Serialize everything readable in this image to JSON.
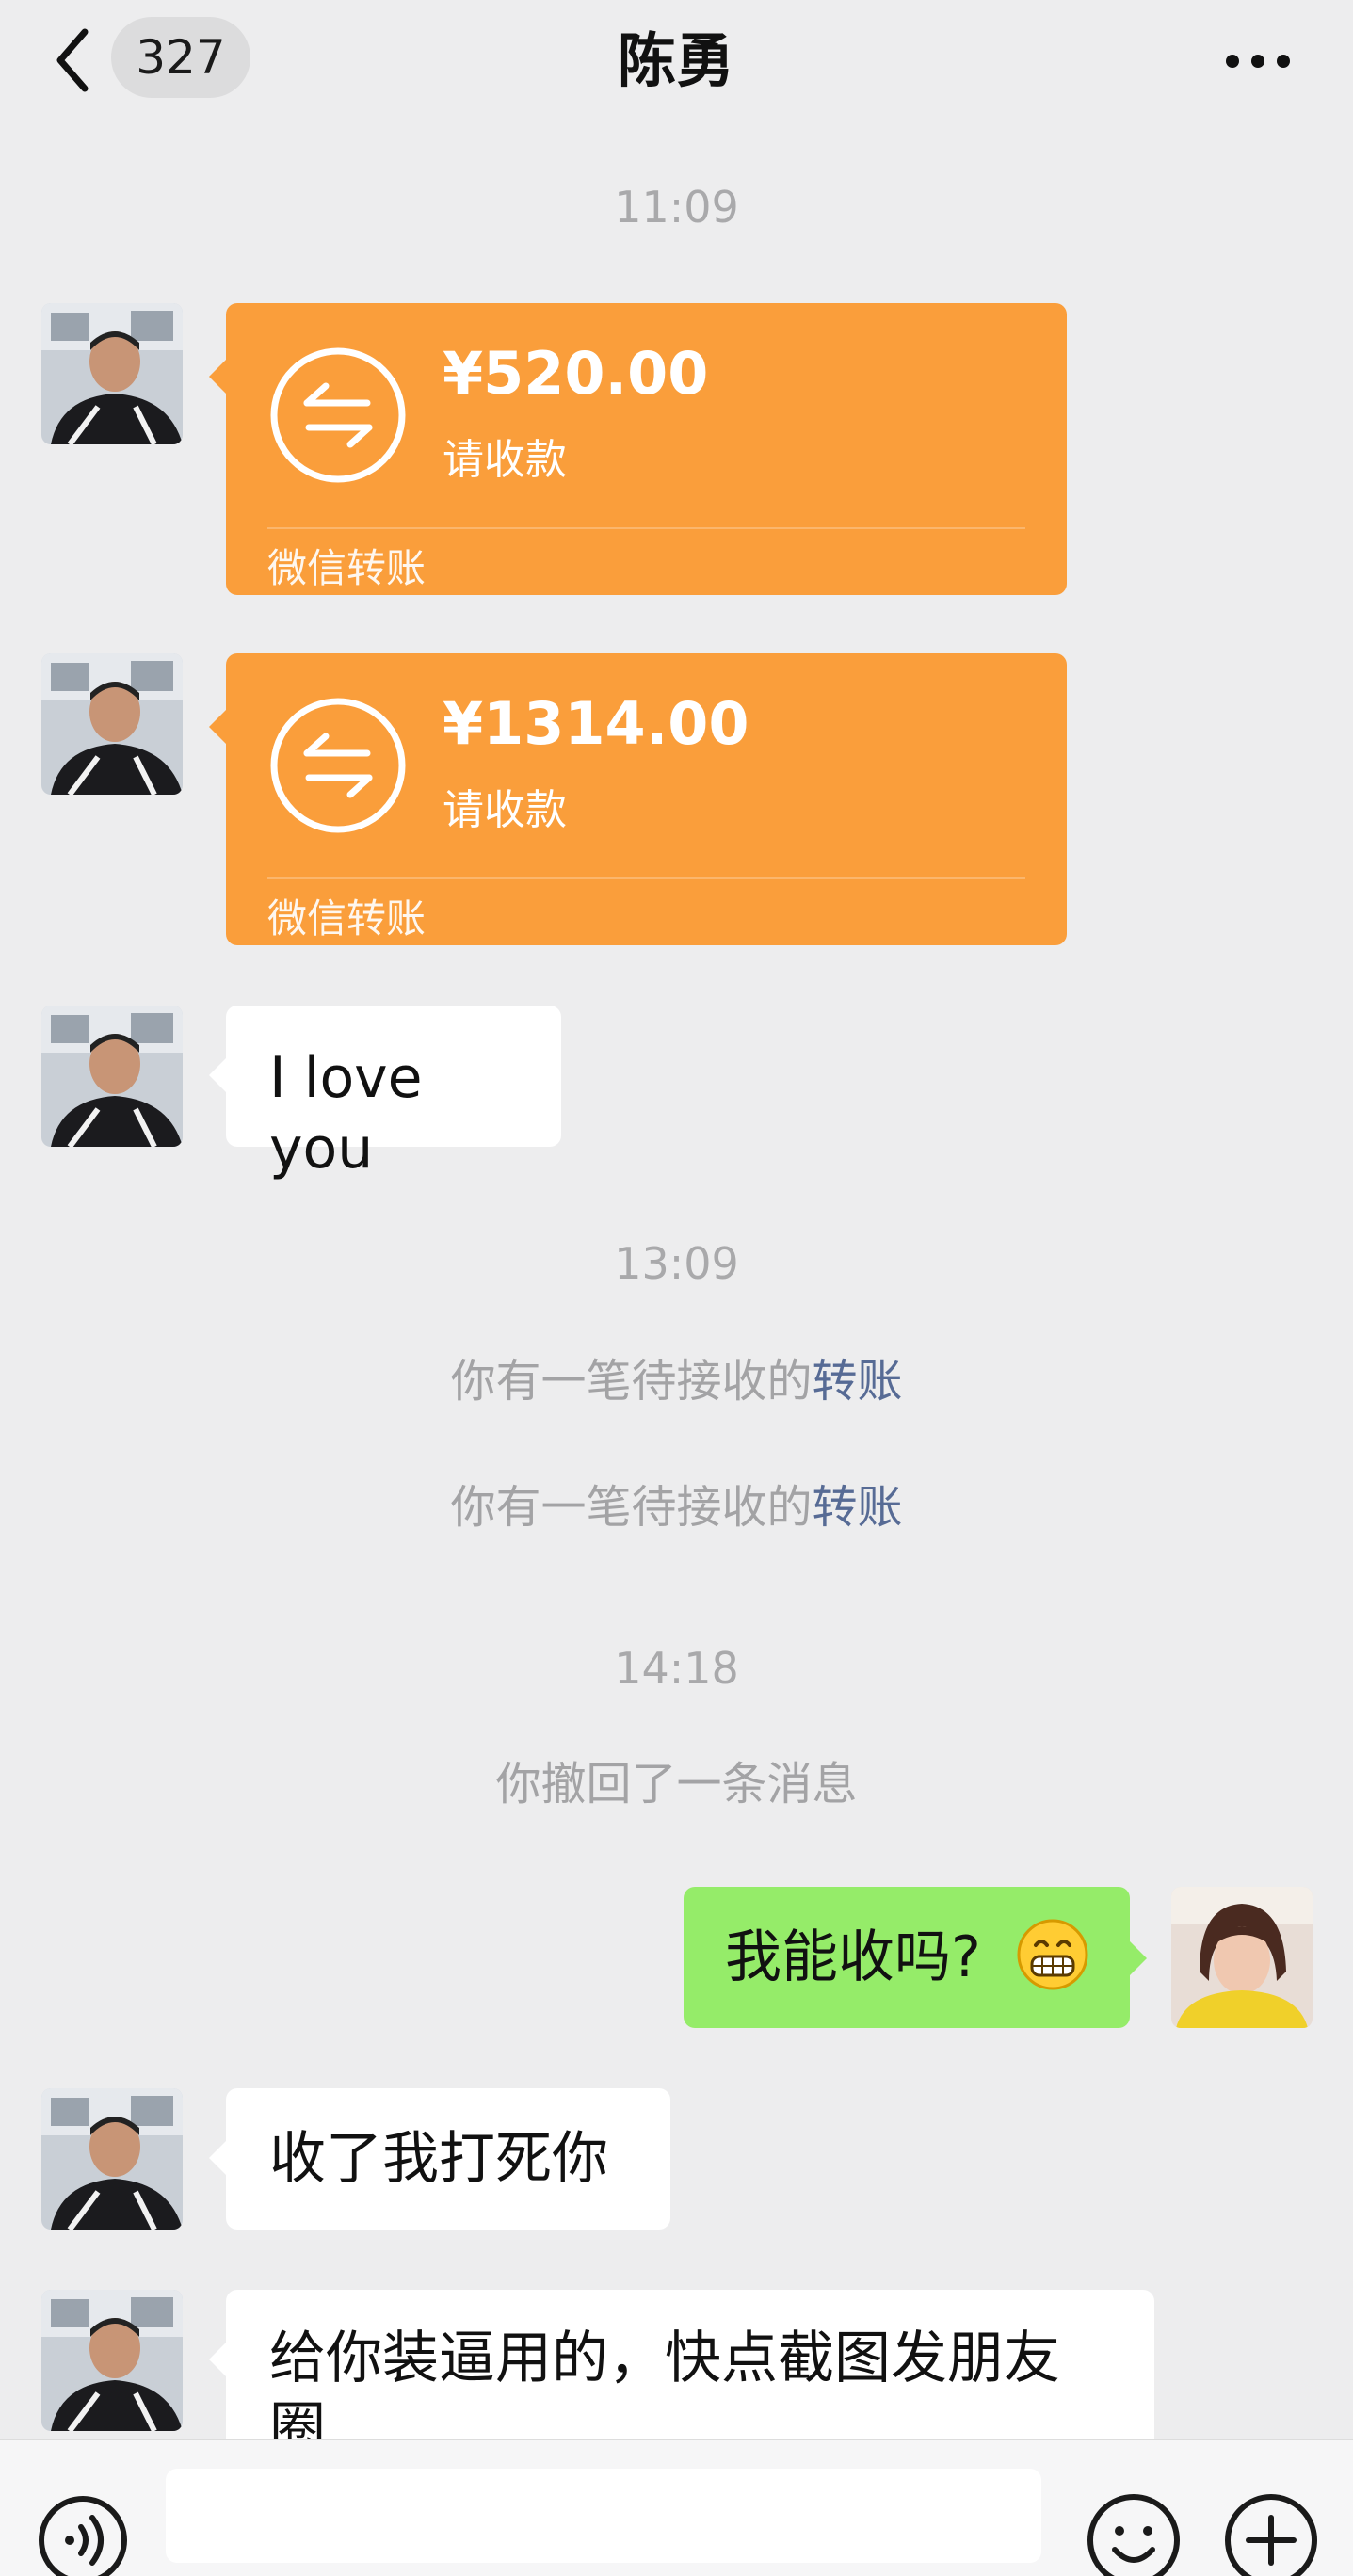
{
  "header": {
    "back_label": "<",
    "unread_count": "327",
    "title": "陈勇",
    "more_label": "..."
  },
  "messages": {
    "time1": "11:09",
    "transfer1": {
      "amount": "¥520.00",
      "status": "请收款",
      "brand": "微信转账"
    },
    "transfer2": {
      "amount": "¥1314.00",
      "status": "请收款",
      "brand": "微信转账"
    },
    "text1": "I love you",
    "time2": "13:09",
    "sys1": {
      "prefix": "你有一笔待接收的",
      "link": "转账"
    },
    "sys2": {
      "prefix": "你有一笔待接收的",
      "link": "转账"
    },
    "time3": "14:18",
    "sys3": "你撤回了一条消息",
    "mine1": "我能收吗?",
    "text2": "收了我打死你",
    "text3": "给你装逼用的，快点截图发朋友圈"
  },
  "colors": {
    "transfer_bg": "#fa9e3b",
    "my_bubble": "#95ec69",
    "their_bubble": "#ffffff",
    "link": "#576b95",
    "chat_bg": "#ededee"
  },
  "icons": {
    "back": "chevron-left-icon",
    "more": "more-dots-icon",
    "transfer": "transfer-arrows-icon",
    "emoji_in_message": "grinning-face-icon",
    "voice": "voice-icon",
    "emoji": "emoji-icon",
    "plus": "plus-icon"
  }
}
